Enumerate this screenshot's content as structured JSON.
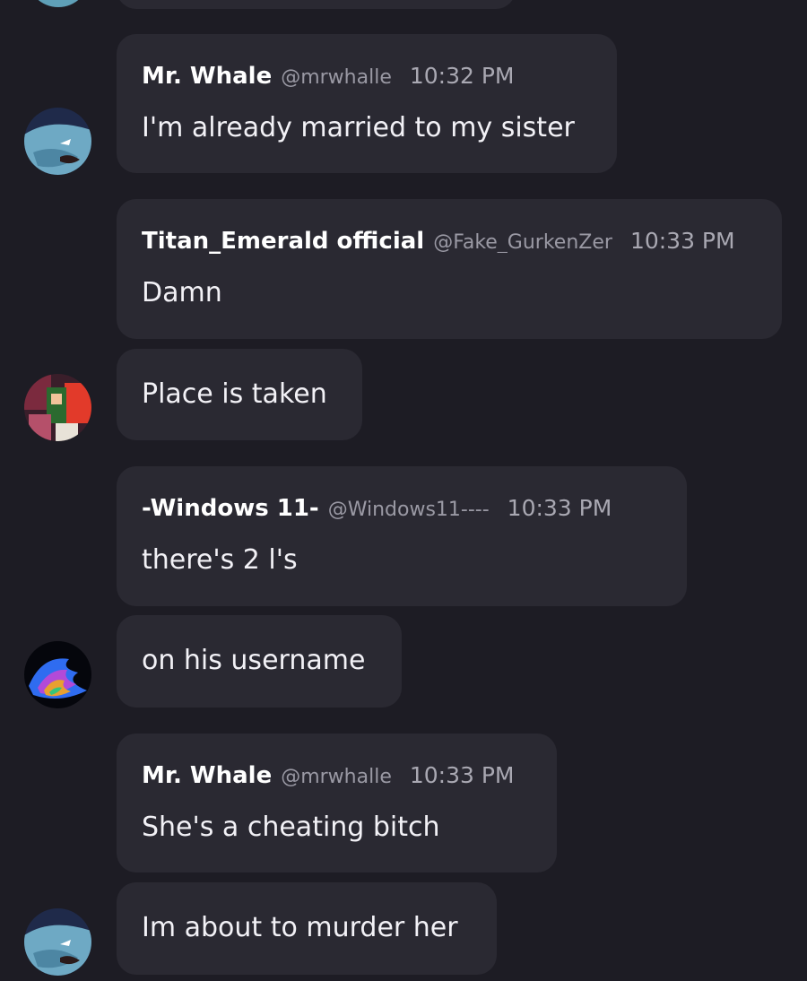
{
  "messages": [
    {
      "author": "Mr. Whale",
      "handle": "@mrwhalle",
      "time": "10:32 PM",
      "text": "I'm already married to my sister"
    },
    {
      "author": "Titan_Emerald official",
      "handle": "@Fake_GurkenZer",
      "time": "10:33 PM",
      "text": "Damn"
    },
    {
      "text": "Place is taken"
    },
    {
      "author": "-Windows 11-",
      "handle": "@Windows11----",
      "time": "10:33 PM",
      "text": "there's 2 l's"
    },
    {
      "text": "on his username"
    },
    {
      "author": "Mr. Whale",
      "handle": "@mrwhalle",
      "time": "10:33 PM",
      "text": "She's a cheating bitch"
    },
    {
      "text": "Im about to murder her"
    }
  ],
  "colors": {
    "background": "#1d1c24",
    "bubble": "#2a2932",
    "text": "#f2f1f6",
    "muted": "#9a99a4"
  }
}
